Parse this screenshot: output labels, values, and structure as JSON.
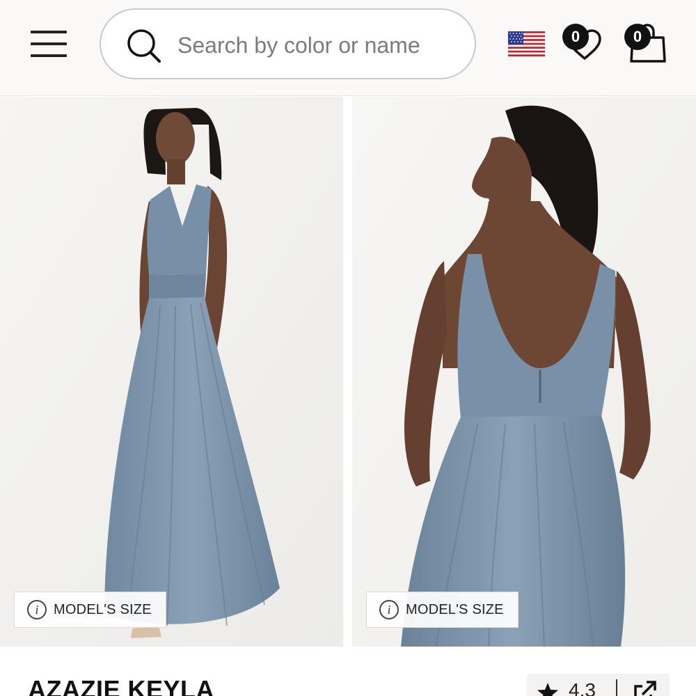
{
  "header": {
    "search": {
      "placeholder": "Search by color or name"
    },
    "wishlist": {
      "count": "0"
    },
    "cart": {
      "count": "0"
    },
    "flag_icon": "us-flag-icon"
  },
  "gallery": {
    "images": [
      {
        "icon": "model-front-photo",
        "model_size_label": "MODEL'S SIZE"
      },
      {
        "icon": "model-back-photo",
        "model_size_label": "MODEL'S SIZE"
      }
    ],
    "dress_color": "#7b93aa"
  },
  "product": {
    "title": "AZAZIE KEYLA",
    "rating": "4.3"
  }
}
